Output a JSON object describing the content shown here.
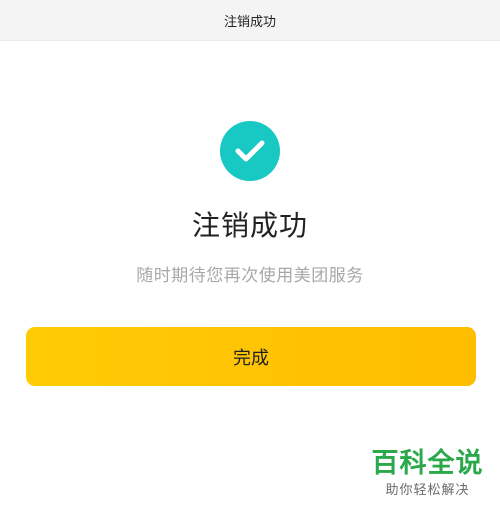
{
  "nav": {
    "title": "注销成功"
  },
  "result": {
    "icon": "checkmark-icon",
    "icon_color": "#17c9c2",
    "title": "注销成功",
    "subtitle": "随时期待您再次使用美团服务"
  },
  "actions": {
    "done_label": "完成",
    "accent_color": "#ffc400"
  },
  "watermark": {
    "main": "百科全说",
    "sub": "助你轻松解决",
    "color": "#2ba84a"
  }
}
